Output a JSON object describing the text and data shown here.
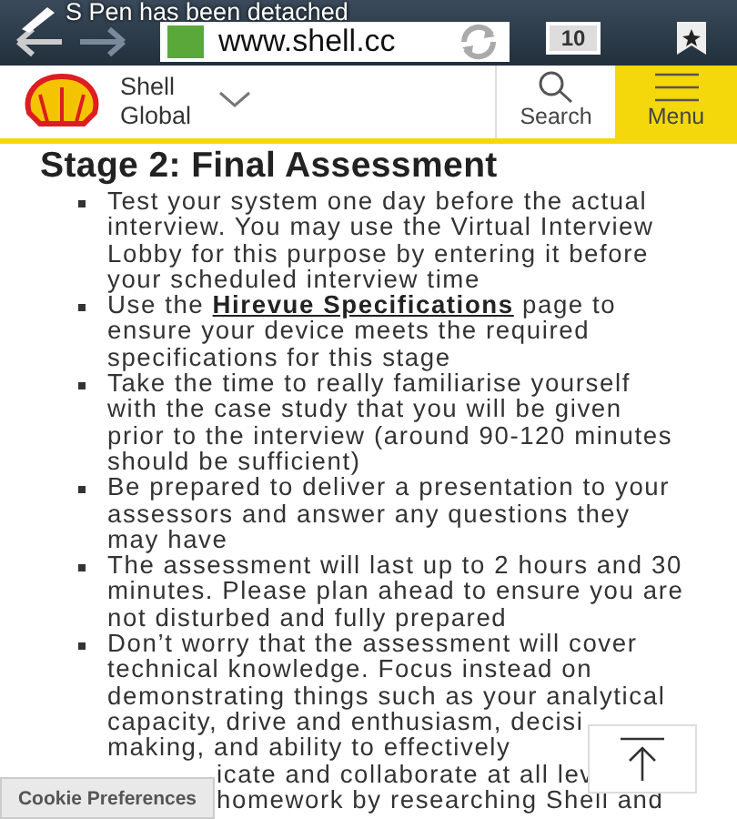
{
  "notification": {
    "text": "S Pen has been detached"
  },
  "browser": {
    "url": "www.shell.cc",
    "tab_count": "10"
  },
  "header": {
    "site_name": "Shell Global",
    "search_label": "Search",
    "menu_label": "Menu"
  },
  "heading": "Stage 2: Final Assessment",
  "items": [
    {
      "kind": "text",
      "segments": [
        {
          "kind": "plain",
          "text": "Test your system one day before the actual interview. You may use the Virtual Interview Lobby for this purpose by entering it before your scheduled interview time"
        }
      ]
    },
    {
      "kind": "text",
      "segments": [
        {
          "kind": "plain",
          "text": "Use the "
        },
        {
          "kind": "link",
          "text": "Hirevue Specifications"
        },
        {
          "kind": "plain",
          "text": " page to ensure your device meets the required specifications for this stage"
        }
      ]
    },
    {
      "kind": "text",
      "segments": [
        {
          "kind": "plain",
          "text": "Take the time to really familiarise yourself with the case study that you will be given prior to the interview (around 90-120 minutes should be sufficient)"
        }
      ]
    },
    {
      "kind": "text",
      "segments": [
        {
          "kind": "plain",
          "text": "Be prepared to deliver a presentation to your assessors and answer any questions they may have"
        }
      ]
    },
    {
      "kind": "text",
      "segments": [
        {
          "kind": "plain",
          "text": "The assessment will last up to 2 hours and 30 minutes. Please plan ahead to ensure you are not disturbed and fully prepared"
        }
      ]
    },
    {
      "kind": "lines",
      "lines": [
        {
          "text": "Don’t worry that the assessment will cover"
        },
        {
          "text": "technical knowledge. Focus instead on"
        },
        {
          "text": "demonstrating things such as your analytical"
        },
        {
          "text": "capacity, drive and enthusiasm, decisi"
        },
        {
          "text": "making, and ability to effectively"
        },
        {
          "text": "icate and collaborate at all lev",
          "cut_start": true
        },
        {
          "text": "homework by researching Shell and",
          "cut_start": true
        }
      ]
    }
  ],
  "cookie_button": "Cookie Preferences"
}
